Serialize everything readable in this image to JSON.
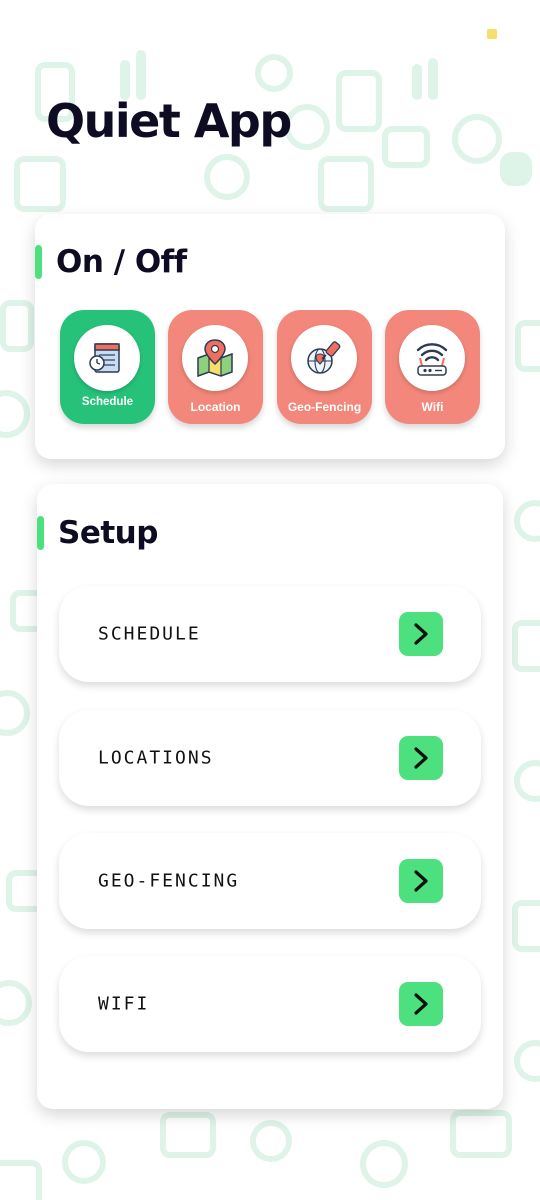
{
  "app": {
    "title": "Quiet App"
  },
  "onoff": {
    "title": "On / Off",
    "toggles": [
      {
        "label": "Schedule",
        "icon": "calendar-clock-icon",
        "state": "on",
        "color": "#27c27a"
      },
      {
        "label": "Location",
        "icon": "map-pin-icon",
        "state": "off",
        "color": "#f3877b"
      },
      {
        "label": "Geo-Fencing",
        "icon": "globe-pin-icon",
        "state": "off",
        "color": "#f3877b"
      },
      {
        "label": "Wifi",
        "icon": "wifi-router-icon",
        "state": "off",
        "color": "#f3877b"
      }
    ]
  },
  "setup": {
    "title": "Setup",
    "items": [
      {
        "label": "SCHEDULE",
        "icon": "chevron-right-icon"
      },
      {
        "label": "LOCATIONS",
        "icon": "chevron-right-icon"
      },
      {
        "label": "GEO-FENCING",
        "icon": "chevron-right-icon"
      },
      {
        "label": "WIFI",
        "icon": "chevron-right-icon"
      }
    ]
  },
  "colors": {
    "accent": "#4ce07e",
    "active_toggle": "#27c27a",
    "inactive_toggle": "#f3877b",
    "title_text": "#0e0c22",
    "pattern": "#cdeedd"
  }
}
